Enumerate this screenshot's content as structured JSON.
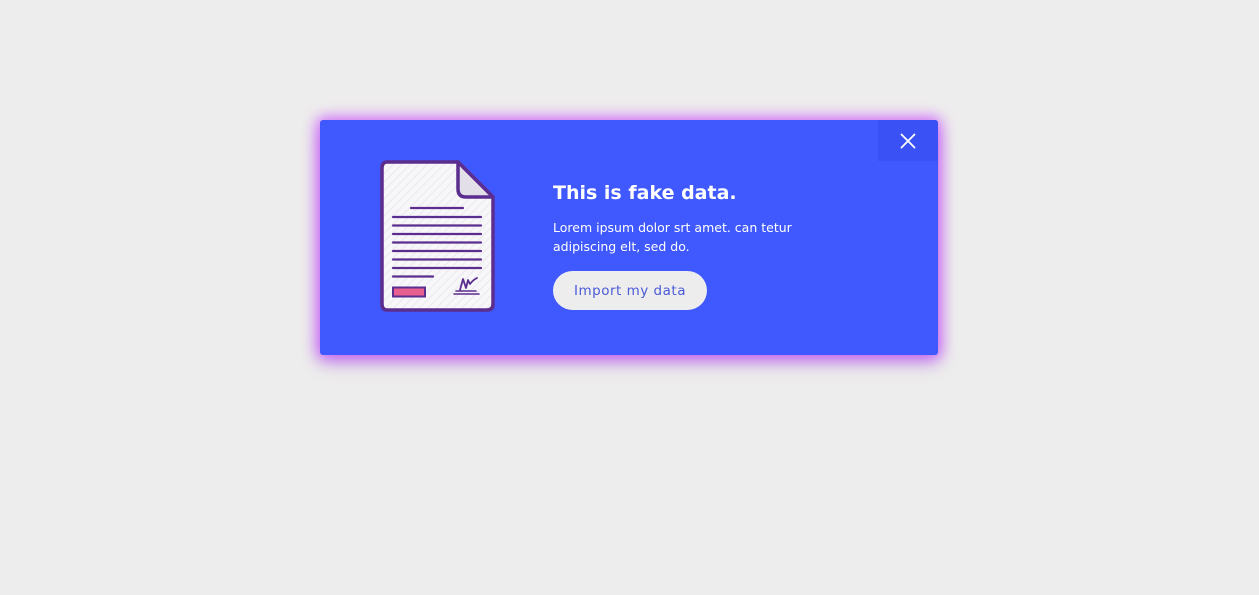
{
  "dialog": {
    "title": "This is fake data.",
    "description": "Lorem ipsum dolor srt amet. can tetur adipiscing elt, sed do.",
    "primary_button_label": "Import my data",
    "close_icon": "close-icon",
    "illustration_icon": "document-icon"
  },
  "colors": {
    "background": "#eeeded",
    "dialog_background": "#4059ff",
    "dialog_glow": "#c846ff",
    "close_button_background": "#3a52f5",
    "button_background": "#eeeded",
    "button_text": "#4a5ad8",
    "document_outline": "#5b2d8e",
    "document_accent": "#e8608f"
  }
}
